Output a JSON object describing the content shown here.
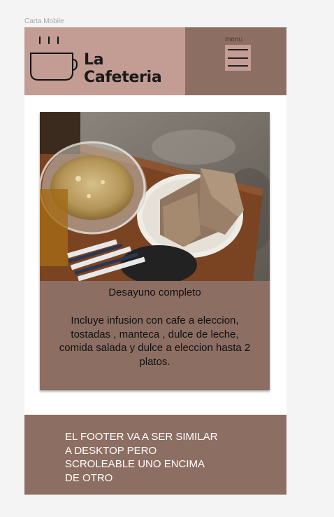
{
  "frame": {
    "label": "Carta Mobile"
  },
  "header": {
    "brand_name": "La Cafeteria",
    "menu_label": "menu",
    "logo_icon": "coffee-cup-icon",
    "menu_icon": "hamburger-icon"
  },
  "card": {
    "image": "breakfast-photo",
    "title": "Desayuno completo",
    "description": "Incluye infusion con cafe a eleccion, tostadas , manteca , dulce de leche, comida salada y dulce a eleccion hasta 2 platos."
  },
  "footer": {
    "text": "EL FOOTER VA A SER SIMILAR A DESKTOP PERO SCROLEABLE UNO ENCIMA DE OTRO"
  },
  "colors": {
    "page_bg": "#f4f4f4",
    "brand_bg": "#c39c93",
    "accent_brown": "#8d6e63",
    "frame_bg": "#ffffff"
  }
}
